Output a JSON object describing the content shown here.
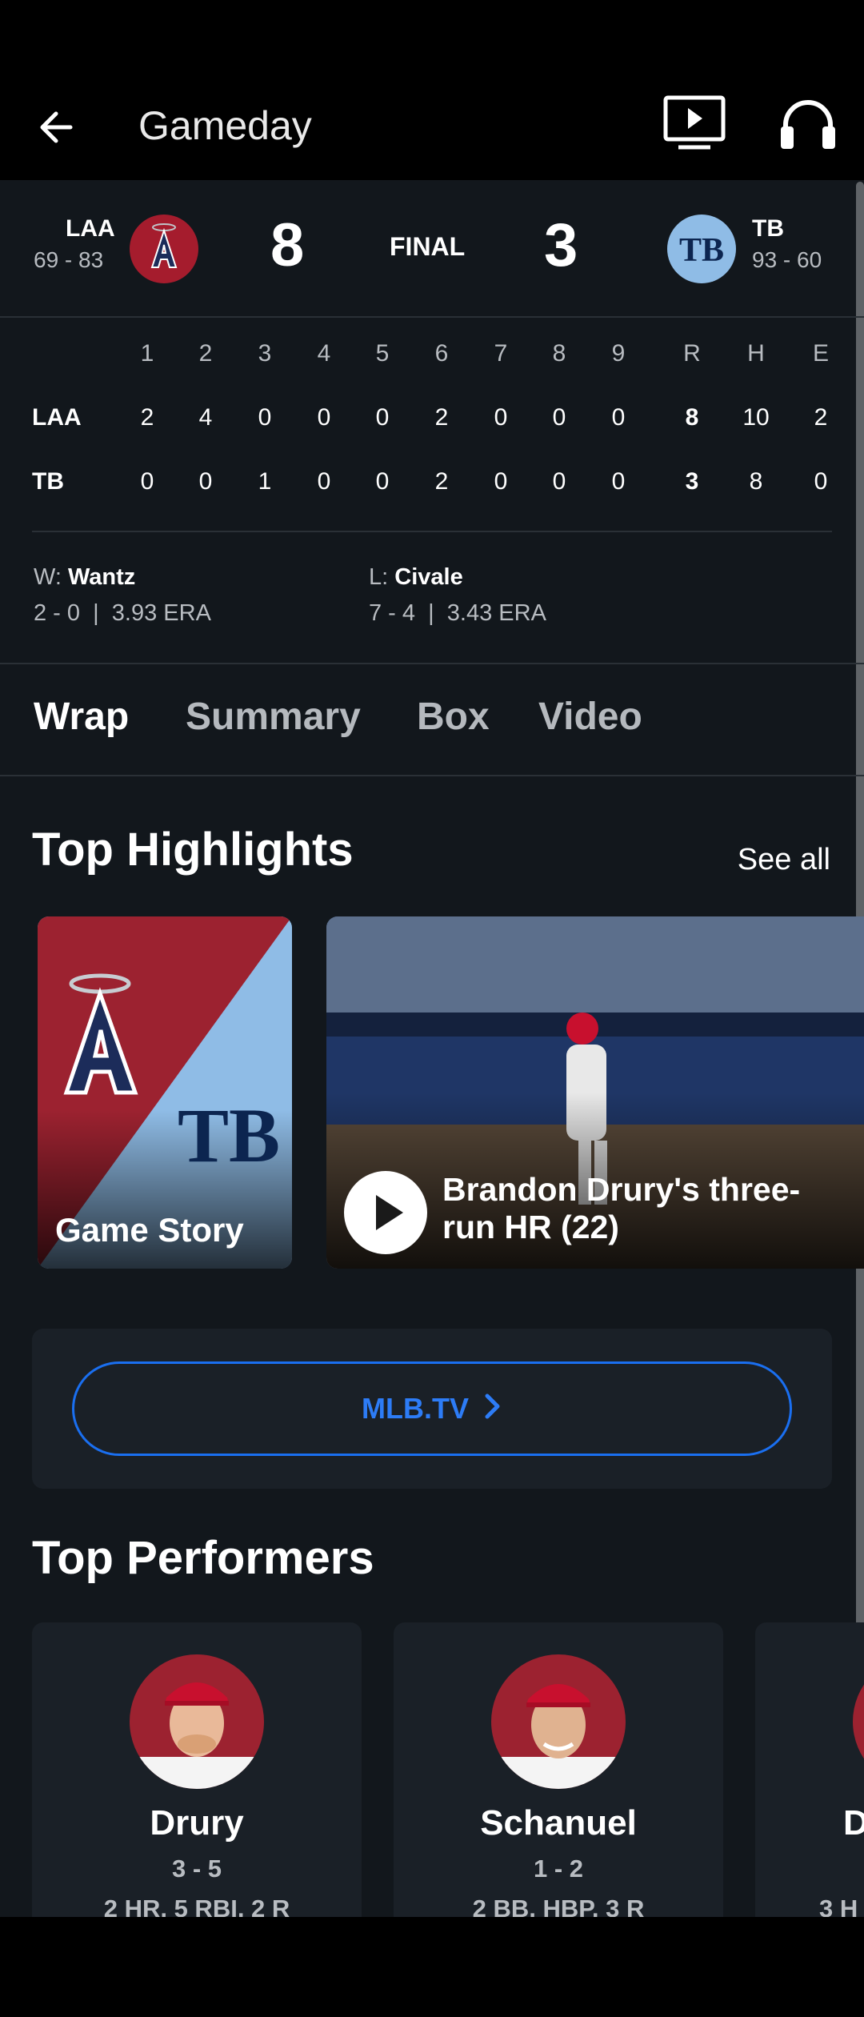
{
  "appbar": {
    "title": "Gameday",
    "icons": [
      "back-arrow-icon",
      "tv-play-icon",
      "headphones-icon"
    ]
  },
  "score": {
    "away": {
      "abbr": "LAA",
      "record": "69 - 83",
      "runs": "8",
      "logo": "angels-logo",
      "logo_color": "#a51c2d"
    },
    "home": {
      "abbr": "TB",
      "record": "93 - 60",
      "runs": "3",
      "logo": "rays-logo",
      "logo_color": "#8fbce6"
    },
    "status": "FINAL"
  },
  "linescore": {
    "headers": [
      "1",
      "2",
      "3",
      "4",
      "5",
      "6",
      "7",
      "8",
      "9",
      "R",
      "H",
      "E"
    ],
    "rows": [
      {
        "team": "LAA",
        "innings": [
          "2",
          "4",
          "0",
          "0",
          "0",
          "2",
          "0",
          "0",
          "0"
        ],
        "rhe": [
          "8",
          "10",
          "2"
        ]
      },
      {
        "team": "TB",
        "innings": [
          "0",
          "0",
          "1",
          "0",
          "0",
          "2",
          "0",
          "0",
          "0"
        ],
        "rhe": [
          "3",
          "8",
          "0"
        ]
      }
    ]
  },
  "pitchers": {
    "win": {
      "prefix": "W:",
      "name": "Wantz",
      "record": "2 - 0",
      "era": "3.93 ERA"
    },
    "loss": {
      "prefix": "L:",
      "name": "Civale",
      "record": "7 - 4",
      "era": "3.43 ERA"
    }
  },
  "tabs": [
    "Wrap",
    "Summary",
    "Box",
    "Video"
  ],
  "highlights": {
    "title": "Top Highlights",
    "see_all": "See all",
    "story_label": "Game Story",
    "video_title": "Brandon Drury's three-run HR (22)"
  },
  "mlbtv": {
    "label": "MLB.TV"
  },
  "performers": {
    "title": "Top Performers",
    "items": [
      {
        "name": "Drury",
        "line1": "3 - 5",
        "line2": "2 HR, 5 RBI, 2 R"
      },
      {
        "name": "Schanuel",
        "line1": "1 - 2",
        "line2": "2 BB, HBP, 3 R"
      },
      {
        "name": "D",
        "line1": "",
        "line2": "3 H"
      }
    ]
  },
  "colors": {
    "accent": "#1a6ff0",
    "background": "#12171c",
    "card": "#1a2027"
  }
}
